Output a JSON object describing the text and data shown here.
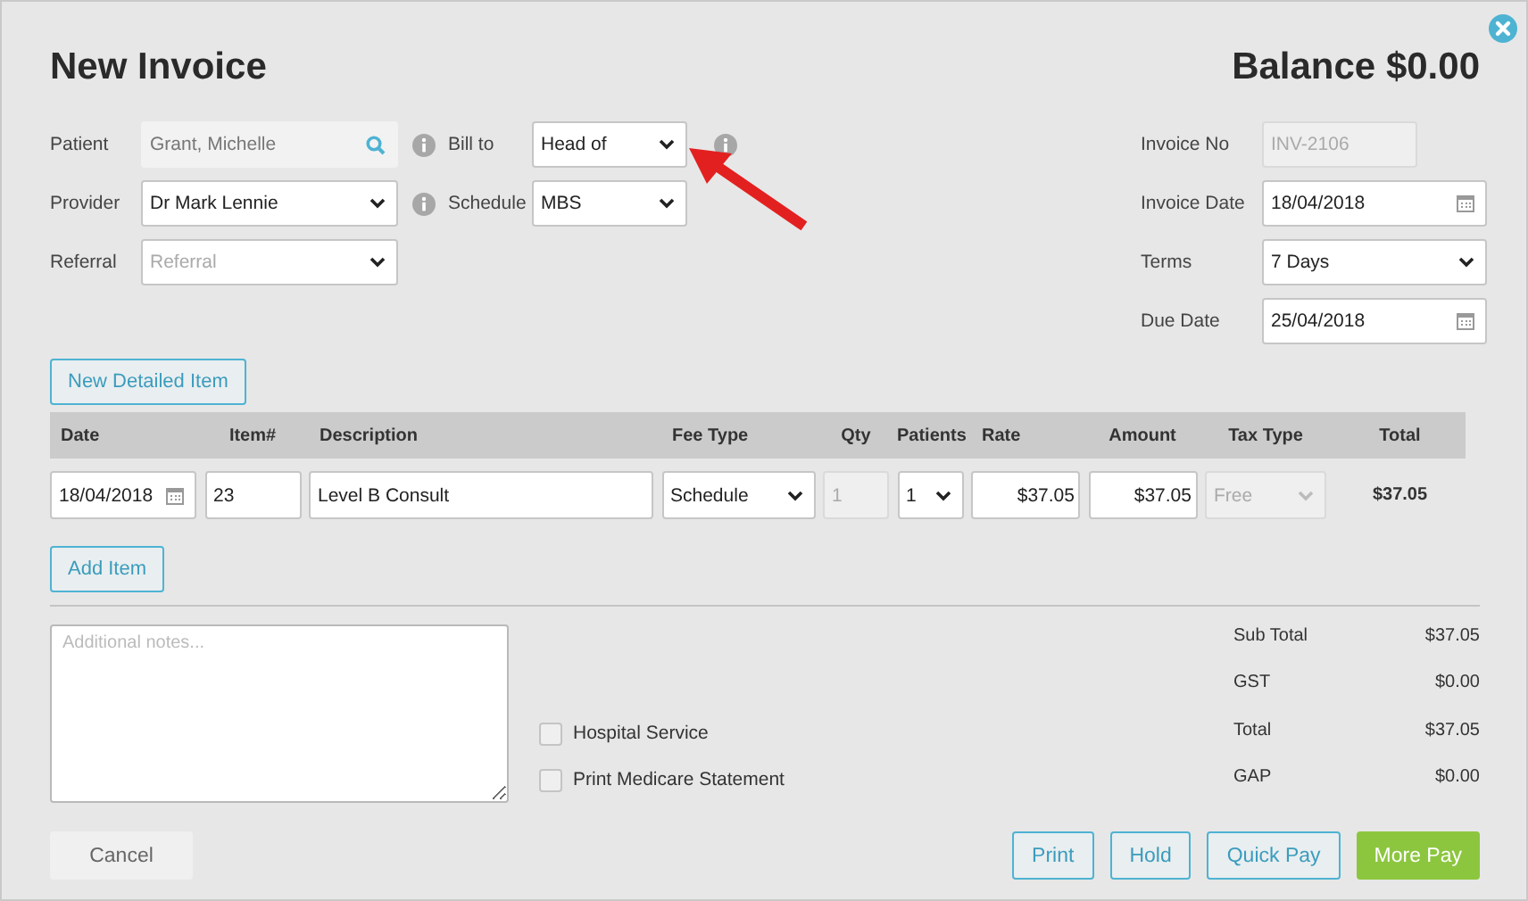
{
  "title": "New Invoice",
  "balance": "Balance $0.00",
  "left_fields": [
    {
      "label": "Patient",
      "kind": "search",
      "value": "Grant, Michelle",
      "info": true
    },
    {
      "label": "Provider",
      "kind": "select",
      "value": "Dr Mark Lennie",
      "info": true
    },
    {
      "label": "Referral",
      "kind": "select",
      "placeholder": "Referral",
      "info": false
    }
  ],
  "middle_fields": [
    {
      "label": "Bill to",
      "kind": "select",
      "value": "Head of",
      "info": true
    },
    {
      "label": "Schedule",
      "kind": "select",
      "value": "MBS",
      "info": false
    }
  ],
  "right_fields": [
    {
      "label": "Invoice No",
      "kind": "readonly",
      "value": "INV-2106"
    },
    {
      "label": "Invoice Date",
      "kind": "date",
      "value": "18/04/2018"
    },
    {
      "label": "Terms",
      "kind": "select",
      "value": "7 Days"
    },
    {
      "label": "Due Date",
      "kind": "date",
      "value": "25/04/2018"
    }
  ],
  "new_item_button": "New Detailed Item",
  "table": {
    "columns": [
      "Date",
      "Item#",
      "Description",
      "Fee Type",
      "Qty",
      "Patients",
      "Rate",
      "Amount",
      "Tax Type",
      "Total"
    ],
    "rows": [
      [
        {
          "kind": "date",
          "value": "18/04/2018"
        },
        {
          "kind": "text",
          "value": "23"
        },
        {
          "kind": "text",
          "value": "Level B Consult"
        },
        {
          "kind": "select",
          "value": "Schedule"
        },
        {
          "kind": "readonly",
          "value": "1"
        },
        {
          "kind": "select",
          "value": "1"
        },
        {
          "kind": "money",
          "value": "$37.05"
        },
        {
          "kind": "money",
          "value": "$37.05"
        },
        {
          "kind": "readonly_select",
          "value": "Free"
        },
        {
          "kind": "plain",
          "value": "$37.05"
        }
      ]
    ]
  },
  "add_item_button": "Add Item",
  "notes": {
    "placeholder": "Additional notes..."
  },
  "checkboxes": [
    {
      "label": "Hospital Service",
      "checked": false
    },
    {
      "label": "Print Medicare Statement",
      "checked": false
    }
  ],
  "totals": [
    {
      "label": "Sub Total",
      "value": "$37.05"
    },
    {
      "label": "GST",
      "value": "$0.00"
    },
    {
      "label": "Total",
      "value": "$37.05"
    },
    {
      "label": "GAP",
      "value": "$0.00"
    }
  ],
  "buttons": [
    {
      "label": "Cancel",
      "kind": "plain"
    },
    {
      "label": "Print",
      "kind": "outline"
    },
    {
      "label": "Hold",
      "kind": "outline"
    },
    {
      "label": "Quick Pay",
      "kind": "outline"
    },
    {
      "label": "More Pay",
      "kind": "primary"
    }
  ]
}
